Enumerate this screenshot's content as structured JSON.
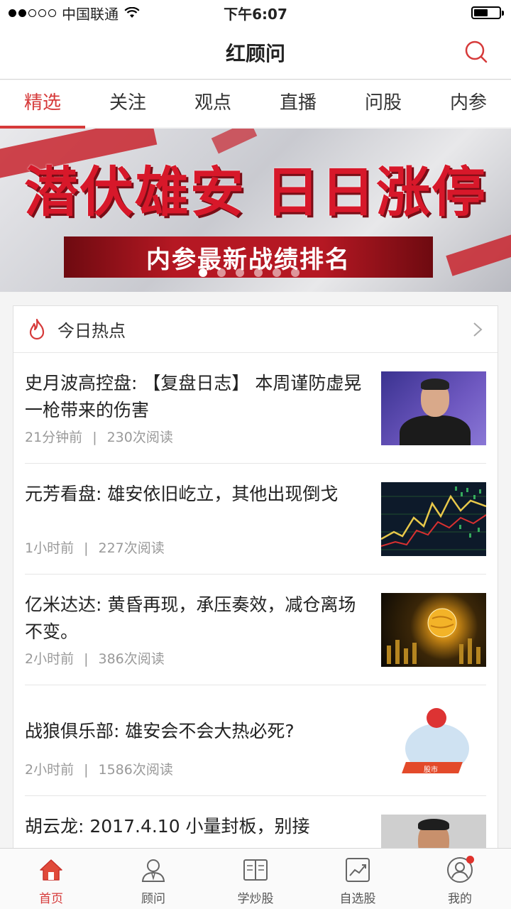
{
  "status_bar": {
    "carrier": "中国联通",
    "time": "下午6:07"
  },
  "nav": {
    "title": "红顾问"
  },
  "tabs": [
    {
      "label": "精选",
      "active": true
    },
    {
      "label": "关注",
      "active": false
    },
    {
      "label": "观点",
      "active": false
    },
    {
      "label": "直播",
      "active": false
    },
    {
      "label": "问股",
      "active": false
    },
    {
      "label": "内参",
      "active": false
    }
  ],
  "banner": {
    "headline_left": "潜伏雄安",
    "headline_right": "日日涨停",
    "ribbon": "内参最新战绩排名",
    "page_count": 6,
    "current_page": 1
  },
  "hot": {
    "title": "今日热点",
    "articles": [
      {
        "title": "史月波高控盘: 【复盘日志】 本周谨防虚晃一枪带来的伤害",
        "time": "21分钟前",
        "reads": "230次阅读",
        "thumb": "person-portrait"
      },
      {
        "title": "元芳看盘: 雄安依旧屹立，其他出现倒戈",
        "time": "1小时前",
        "reads": "227次阅读",
        "thumb": "stock-chart"
      },
      {
        "title": "亿米达达: 黄昏再现，承压奏效，减仓离场不变。",
        "time": "2小时前",
        "reads": "386次阅读",
        "thumb": "golden-globe"
      },
      {
        "title": "战狼俱乐部: 雄安会不会大热必死?",
        "time": "2小时前",
        "reads": "1586次阅读",
        "thumb": "cartoon-market",
        "cartoon_label": "股市"
      },
      {
        "title": "胡云龙: 2017.4.10  小量封板，别接",
        "time": "",
        "reads": "",
        "thumb": "person-portrait"
      }
    ]
  },
  "tabbar": [
    {
      "label": "首页",
      "icon": "home-icon",
      "active": true
    },
    {
      "label": "顾问",
      "icon": "advisor-icon",
      "active": false
    },
    {
      "label": "学炒股",
      "icon": "book-icon",
      "active": false
    },
    {
      "label": "自选股",
      "icon": "stock-trend-icon",
      "active": false
    },
    {
      "label": "我的",
      "icon": "profile-icon",
      "active": false,
      "badge": true
    }
  ],
  "colors": {
    "accent": "#d63a3a",
    "banner_red": "#d7182a"
  }
}
